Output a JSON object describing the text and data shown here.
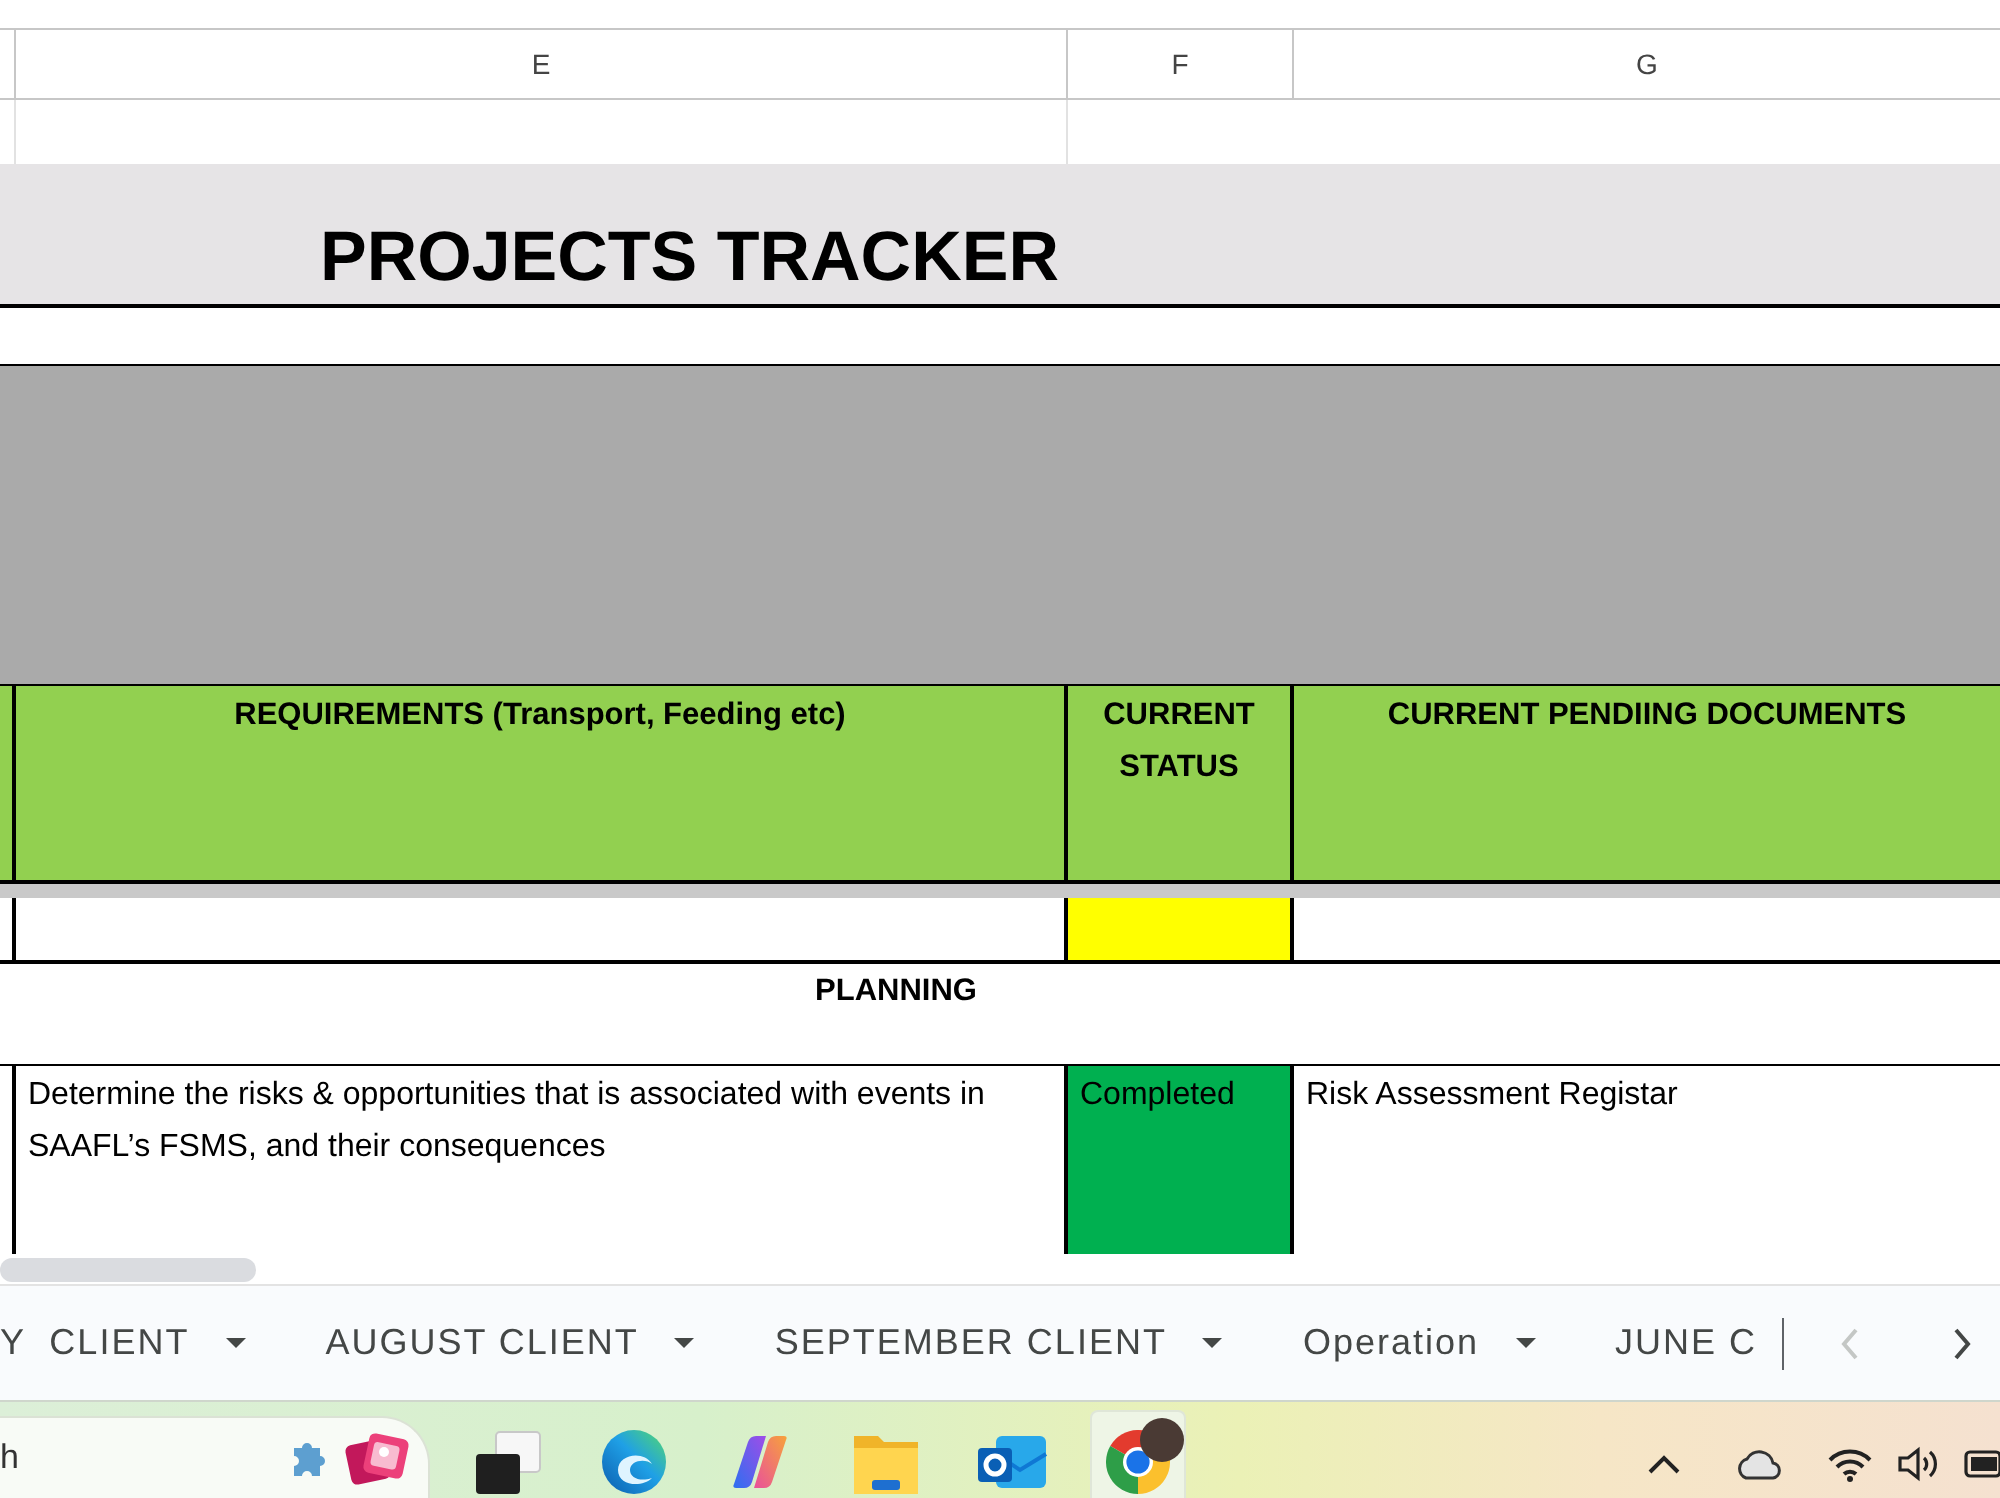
{
  "column_letters": [
    "E",
    "F",
    "G"
  ],
  "title": "PROJECTS TRACKER",
  "table": {
    "columns": [
      "REQUIREMENTS (Transport, Feeding etc)",
      "CURRENT STATUS",
      "CURRENT PENDIING DOCUMENTS"
    ],
    "rows": [
      {
        "kind": "entry",
        "color": "#ffff00"
      },
      {
        "kind": "section",
        "label": "PLANNING"
      },
      {
        "kind": "entry",
        "requirement": "Determine the risks & opportunities that is associated with events in SAAFL’s FSMS, and their consequences",
        "status": "Completed",
        "color": "#00b050",
        "documents": "Risk Assessment Registar"
      }
    ]
  },
  "sheet_tabs": [
    {
      "label": "Y  CLIENT",
      "menu": true
    },
    {
      "label": "AUGUST CLIENT",
      "menu": true
    },
    {
      "label": "SEPTEMBER CLIENT",
      "menu": true
    },
    {
      "label": "Operation",
      "menu": true
    },
    {
      "label": "JUNE C",
      "menu": false
    }
  ],
  "tab_scroll": [
    {
      "kind": "left",
      "disabled": true
    },
    {
      "kind": "right",
      "disabled": false
    }
  ],
  "taskbar": {
    "search": {
      "value": "h"
    },
    "apps": [
      {
        "kind": "windows",
        "active": false
      },
      {
        "kind": "swirl",
        "active": false
      },
      {
        "kind": "ribbon",
        "active": false
      },
      {
        "kind": "folder",
        "active": false
      },
      {
        "kind": "mail",
        "active": false
      },
      {
        "kind": "browser",
        "active": true
      }
    ]
  }
}
